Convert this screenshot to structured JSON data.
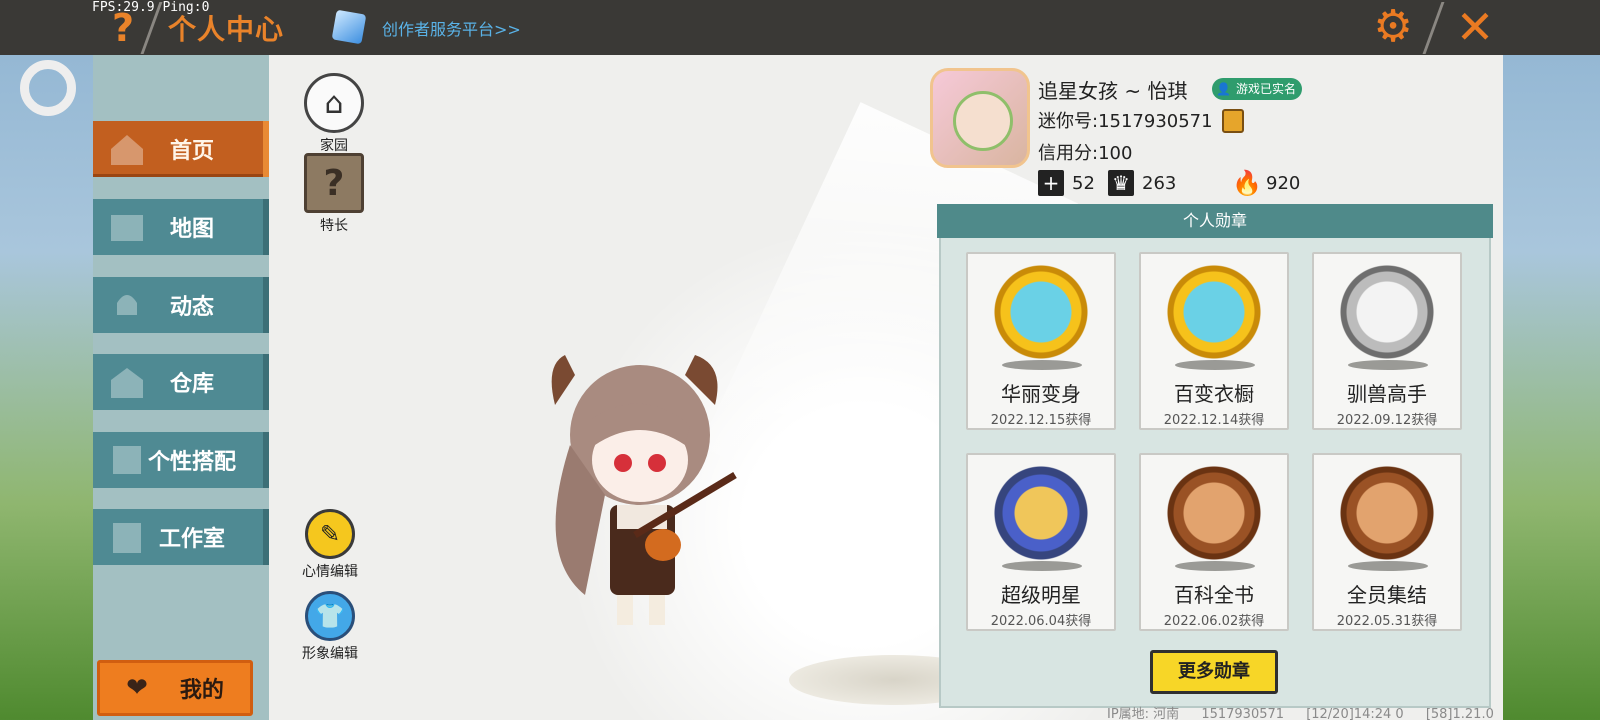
{
  "status": {
    "fps": "FPS:29.9  Ping:0"
  },
  "header": {
    "help": "?",
    "title": "个人中心",
    "creator_link": "创作者服务平台>>",
    "settings": "settings",
    "close": "close"
  },
  "sidebar": {
    "items": [
      {
        "label": "首页",
        "icon": "house-icon",
        "active": true
      },
      {
        "label": "地图",
        "icon": "map-icon",
        "active": false
      },
      {
        "label": "动态",
        "icon": "bell-icon",
        "active": false
      },
      {
        "label": "仓库",
        "icon": "warehouse-icon",
        "active": false
      },
      {
        "label": "个性搭配",
        "icon": "outfit-icon",
        "active": false
      },
      {
        "label": "工作室",
        "icon": "studio-icon",
        "active": false
      }
    ],
    "mine_label": "我的"
  },
  "tools": {
    "home_label": "家园",
    "talent_label": "特长",
    "mood_label": "心情编辑",
    "look_label": "形象编辑"
  },
  "profile": {
    "nickname": "追星女孩 ~ 怡琪",
    "realname_badge": "游戏已实名",
    "mini_id": "迷你号:1517930571",
    "credit": "信用分:100",
    "stats": {
      "friends": "52",
      "fans": "263",
      "popularity": "920"
    }
  },
  "medals": {
    "title": "个人勋章",
    "items": [
      {
        "name": "华丽变身",
        "date": "2022.12.15获得",
        "tier": "gold"
      },
      {
        "name": "百变衣橱",
        "date": "2022.12.14获得",
        "tier": "gold"
      },
      {
        "name": "驯兽高手",
        "date": "2022.09.12获得",
        "tier": "silver"
      },
      {
        "name": "超级明星",
        "date": "2022.06.04获得",
        "tier": "blue"
      },
      {
        "name": "百科全书",
        "date": "2022.06.02获得",
        "tier": "bronze"
      },
      {
        "name": "全员集结",
        "date": "2022.05.31获得",
        "tier": "bronze"
      }
    ],
    "more_label": "更多勋章"
  },
  "footer": {
    "ip": "IP属地: 河南",
    "uid": "1517930571",
    "time": "[12/20]14:24 0",
    "version": "[58]1.21.0"
  },
  "colors": {
    "accent": "#e9832a",
    "nav": "#4f8a93",
    "nav_active": "#c25f1f",
    "medal_header": "#4f8a8a"
  }
}
